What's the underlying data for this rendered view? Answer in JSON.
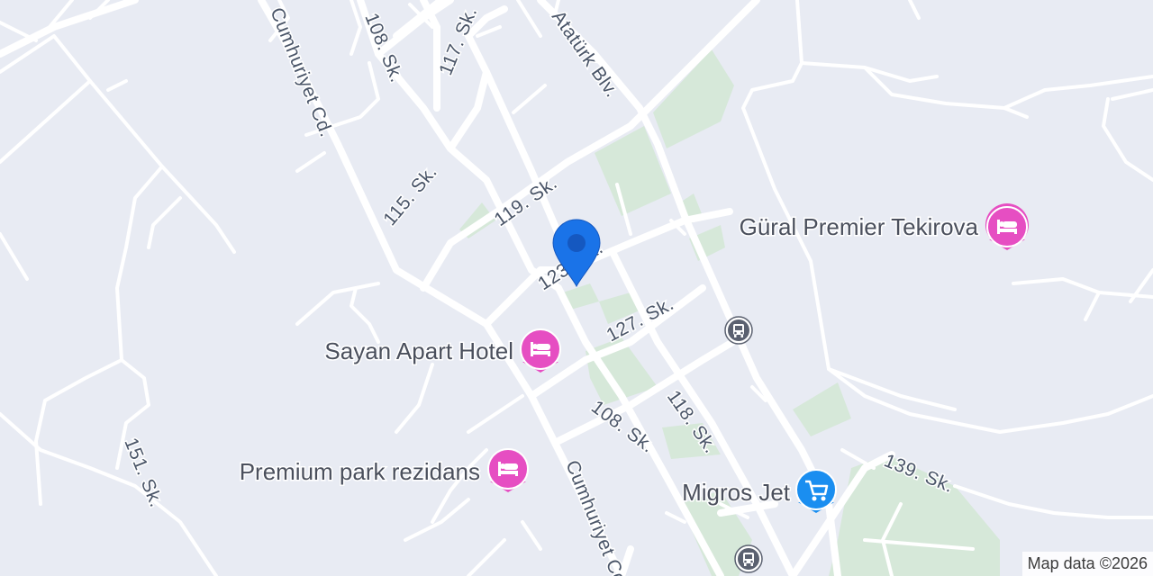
{
  "map": {
    "background_color": "#e8ebf3",
    "park_color": "#d6e8d9",
    "road_color": "#ffffff",
    "streets": {
      "cumhuriyet_north": "Cumhuriyet Cd.",
      "cumhuriyet_south": "Cumhuriyet Cd.",
      "s108_north": "108. Sk.",
      "s108_south": "108. Sk.",
      "s117": "117. Sk.",
      "ataturk": "Atatürk Blv.",
      "s115": "115. Sk.",
      "s119": "119. Sk.",
      "s123": "123. Sk.",
      "s127": "127. Sk.",
      "s118": "118. Sk.",
      "s139": "139. Sk.",
      "s151": "151. Sk."
    },
    "pois": [
      {
        "label": "Gural Premier Tekirova",
        "display": "Güral Premier Tekirova",
        "icon": "hotel-icon",
        "color": "#e64ec2"
      },
      {
        "label": "Sayan Apart Hotel",
        "display": "Sayan Apart Hotel",
        "icon": "hotel-icon",
        "color": "#e64ec2"
      },
      {
        "label": "Premium park rezidans",
        "display": "Premium park rezidans",
        "icon": "hotel-icon",
        "color": "#e64ec2"
      },
      {
        "label": "Migros Jet",
        "display": "Migros Jet",
        "icon": "shopping-cart-icon",
        "color": "#1a8ef0"
      }
    ],
    "transit_icons": [
      "bus-stop-icon",
      "bus-stop-icon"
    ],
    "location_pin": {
      "icon": "location-pin-icon",
      "color": "#1a73e8"
    },
    "attribution": "Map data ©2026"
  }
}
